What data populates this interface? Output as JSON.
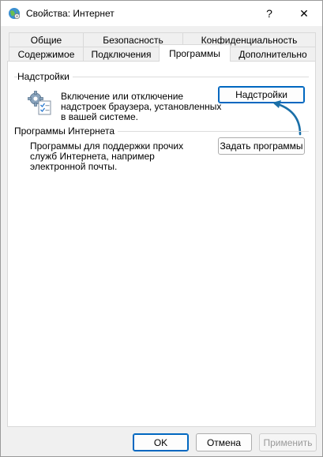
{
  "window": {
    "title": "Свойства: Интернет",
    "help_glyph": "?",
    "close_glyph": "✕"
  },
  "tabs": {
    "row1": [
      "Общие",
      "Безопасность",
      "Конфиденциальность"
    ],
    "row2": [
      "Содержимое",
      "Подключения",
      "Программы",
      "Дополнительно"
    ],
    "active": "Программы"
  },
  "addons": {
    "group_title": "Надстройки",
    "description": [
      "Включение или отключение",
      "надстроек браузера, установленных",
      "в вашей системе."
    ],
    "button_label": "Надстройки",
    "icon": "gear-addons-icon"
  },
  "internet_programs": {
    "group_title": "Программы Интернета",
    "description": [
      "Программы для поддержки прочих",
      "служб Интернета, например",
      "электронной почты."
    ],
    "button_label": "Задать программы"
  },
  "footer": {
    "ok_label": "OK",
    "cancel_label": "Отмена",
    "apply_label": "Применить"
  },
  "colors": {
    "accent": "#0067c0",
    "arrow": "#1a6fa8"
  }
}
